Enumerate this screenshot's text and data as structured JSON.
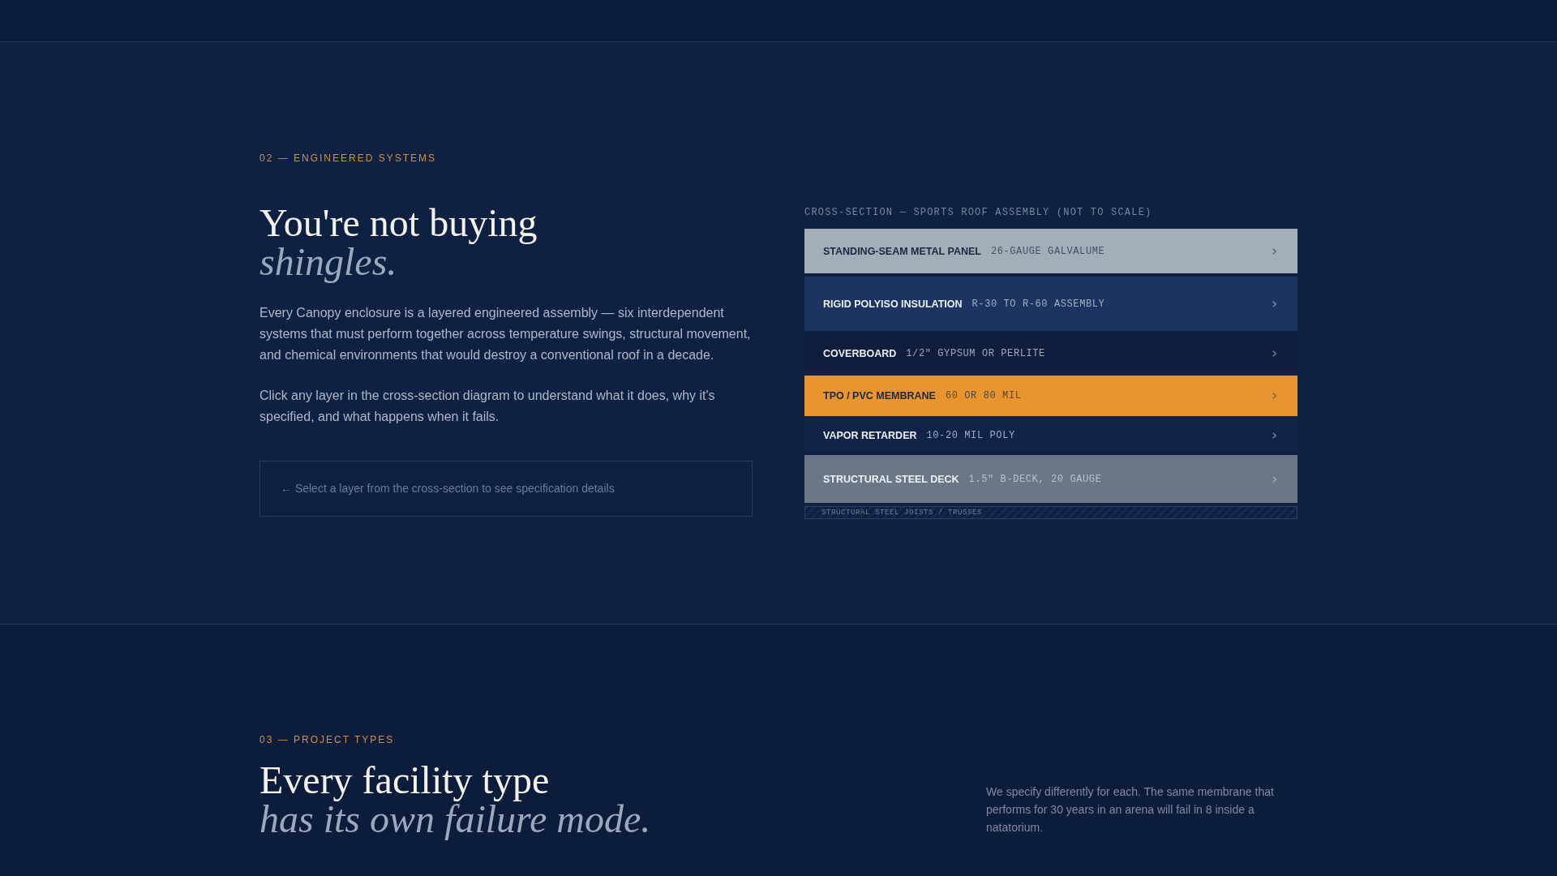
{
  "engineered_systems": {
    "eyebrow": "02 — ENGINEERED SYSTEMS",
    "title": "You're not buying *shingles.*",
    "paragraphs": [
      "Every Canopy enclosure is a layered engineered assembly — six interdependent systems that must perform together across temperature swings, structural movement, and chemical environments that would destroy a conventional roof in a decade.",
      "Click any layer in the cross-section diagram to understand what it does, why it's specified, and what happens when it fails."
    ],
    "detail_panel": {
      "message": "← Select a layer from the cross-section to see specification details"
    },
    "cross_section": {
      "caption": "CROSS-SECTION — SPORTS ROOF ASSEMBLY (NOT TO SCALE)",
      "layers": [
        {
          "name": "STANDING-SEAM METAL PANEL",
          "spec": "26-GAUGE GALVALUME",
          "color": "#a4aeb9",
          "selected": false
        },
        {
          "name": "RIGID POLYISO INSULATION",
          "spec": "R-30 TO R-60 ASSEMBLY",
          "color": "#1b3461",
          "selected": false
        },
        {
          "name": "COVERBOARD",
          "spec": "1/2\" GYPSUM OR PERLITE",
          "color": "#0f1e3c",
          "selected": false
        },
        {
          "name": "TPO / PVC MEMBRANE",
          "spec": "60 OR 80 MIL",
          "color": "#e8952f",
          "selected": false
        },
        {
          "name": "VAPOR RETARDER",
          "spec": "10-20 MIL POLY",
          "color": "#12234a",
          "selected": false
        },
        {
          "name": "STRUCTURAL STEEL DECK",
          "spec": "1.5\" B-DECK, 20 GAUGE",
          "color": "#6b7686",
          "selected": false
        }
      ],
      "base": {
        "label": "STRUCTURAL STEEL JOISTS / TRUSSES"
      }
    }
  },
  "project_types": {
    "eyebrow": "03 — PROJECT TYPES",
    "title": "Every facility type *has its own failure mode.*",
    "intro": "We specify differently for each. The same membrane that performs for 30 years in an arena will fail in 8 inside a natatorium."
  }
}
